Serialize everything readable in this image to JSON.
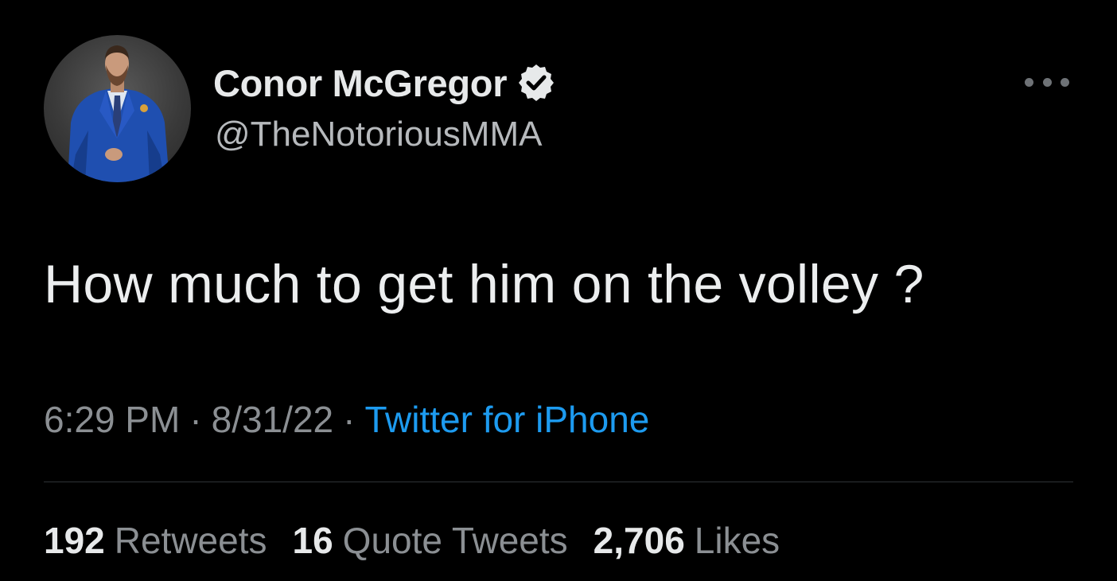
{
  "author": {
    "display_name": "Conor McGregor",
    "handle": "@TheNotoriousMMA",
    "verified": true
  },
  "tweet": {
    "text": "How much to get him on the volley ?",
    "time": "6:29 PM",
    "separator": "·",
    "date": "8/31/22",
    "source": "Twitter for iPhone"
  },
  "stats": [
    {
      "count": "192",
      "label": "Retweets"
    },
    {
      "count": "16",
      "label": "Quote Tweets"
    },
    {
      "count": "2,706",
      "label": "Likes"
    }
  ],
  "icons": {
    "more": "more-horizontal-icon",
    "verified": "verified-badge-icon"
  },
  "colors": {
    "background": "#000000",
    "text": "#e7e9ea",
    "secondary": "#8b8f93",
    "link": "#1d9bf0"
  }
}
